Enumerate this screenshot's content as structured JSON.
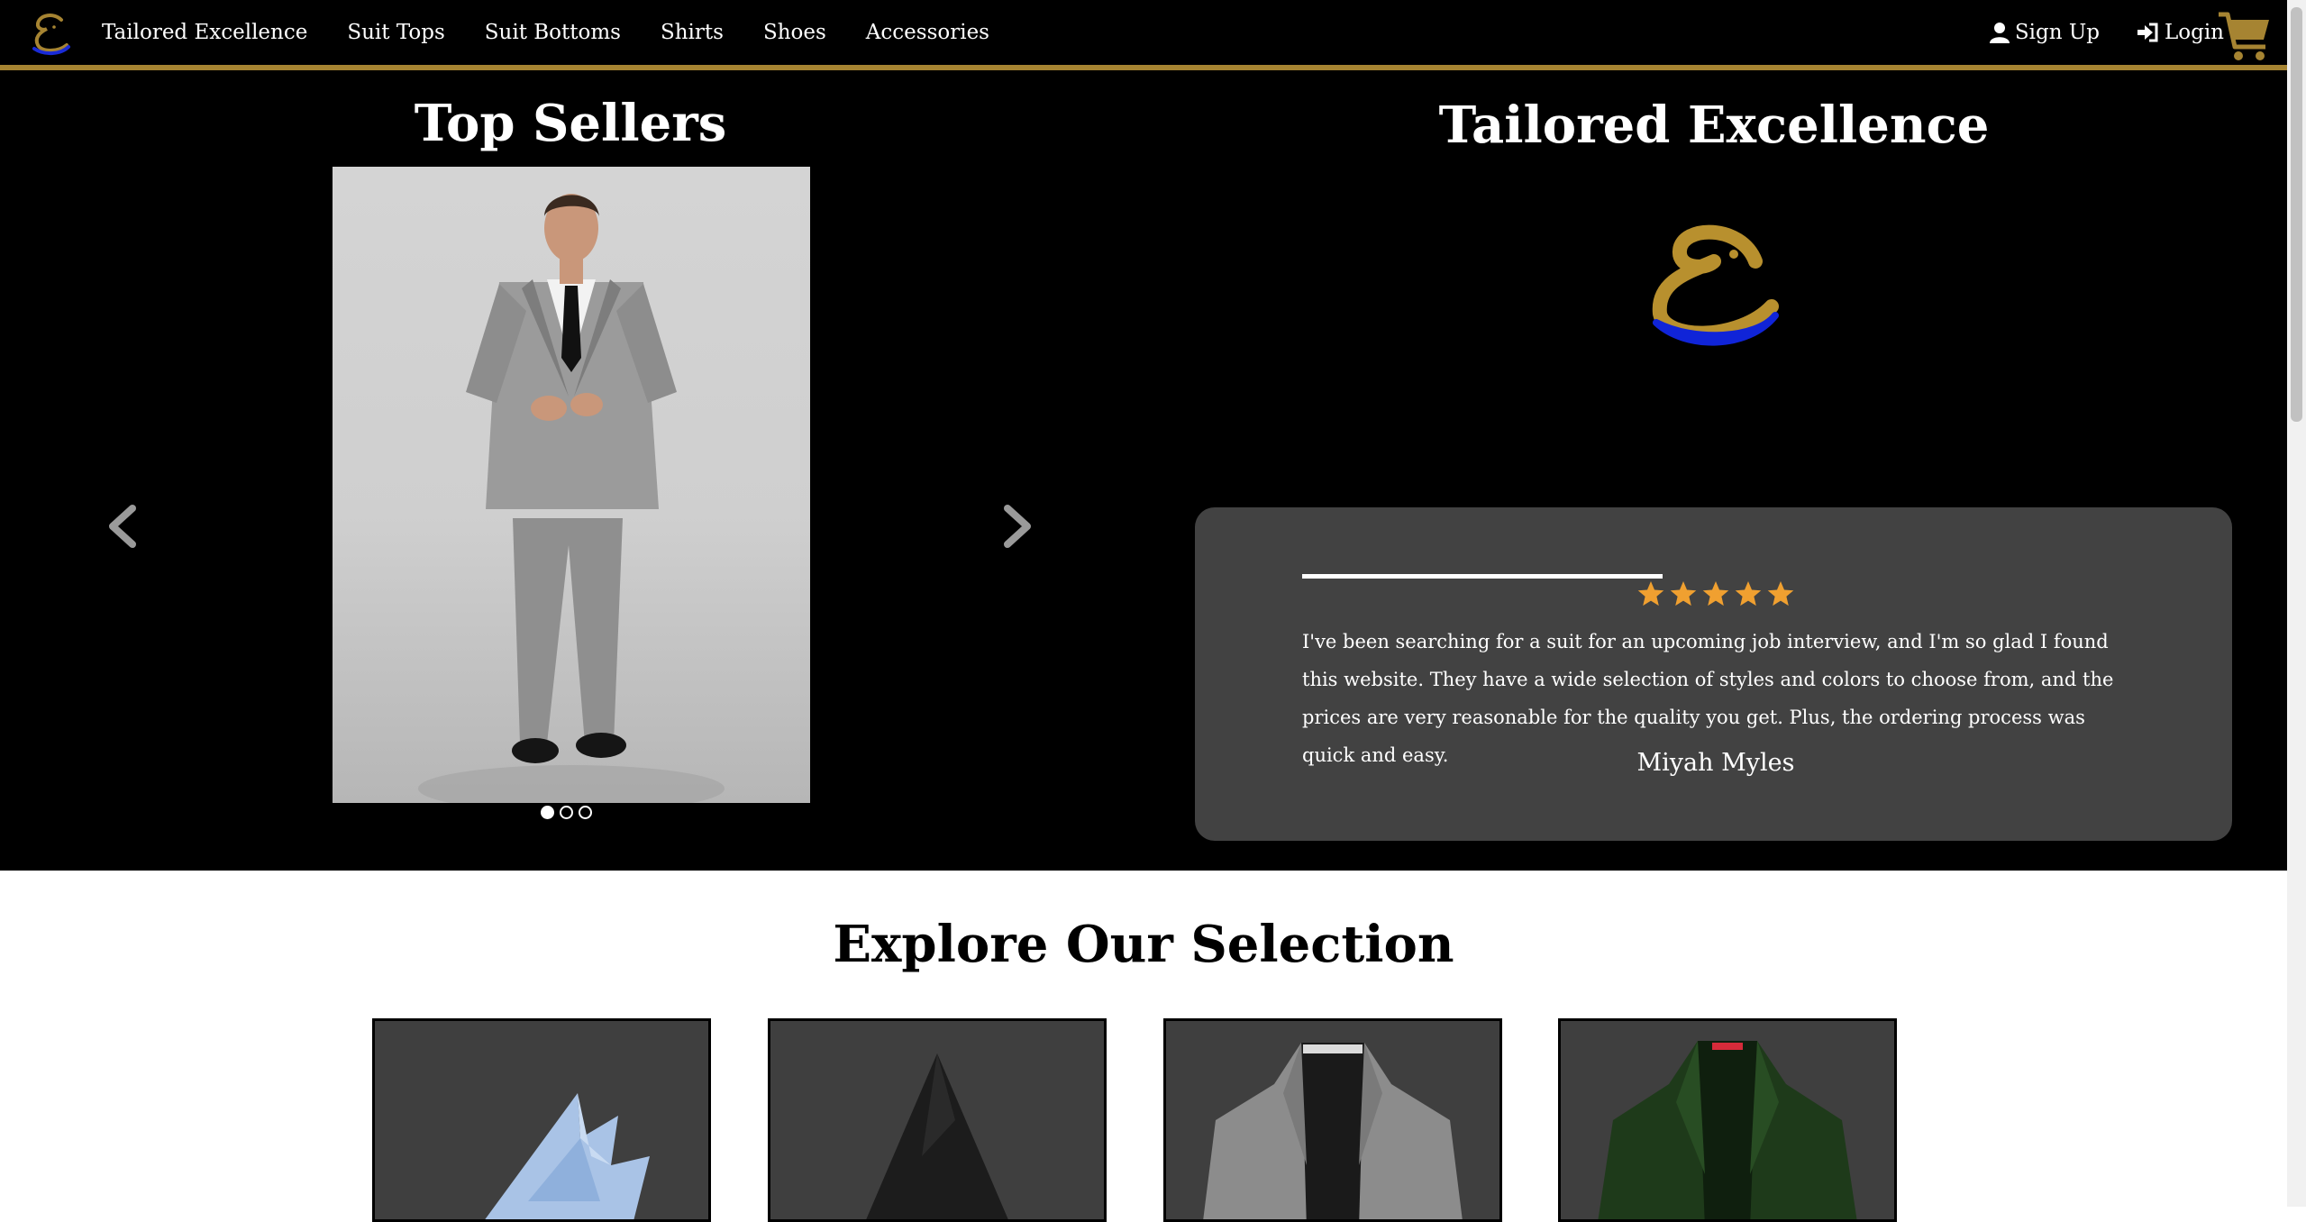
{
  "nav": {
    "brand": "Tailored Excellence",
    "links": [
      "Suit Tops",
      "Suit Bottoms",
      "Shirts",
      "Shoes",
      "Accessories"
    ],
    "signup": "Sign Up",
    "login": "Login",
    "icons": {
      "logo": "brand-logo-icon",
      "signup": "user-icon",
      "login": "sign-in-icon",
      "cart": "cart-icon"
    }
  },
  "hero": {
    "top_sellers_title": "Top Sellers",
    "carousel": {
      "slides": 3,
      "active": 1
    },
    "brand_title": "Tailored Excellence"
  },
  "review": {
    "rating": 5,
    "text": "I've been searching for a suit for an upcoming job interview, and I'm so glad I found this website. They have a wide selection of styles and colors to choose from, and the prices are very reasonable for the quality you get. Plus, the ordering process was quick and easy.",
    "author": "Miyah Myles"
  },
  "explore": {
    "title": "Explore Our Selection",
    "cards": [
      "pocket-square",
      "tie",
      "grey-blazer",
      "green-blazer"
    ]
  },
  "colors": {
    "gold": "#a68432",
    "black": "#000000",
    "review_bg": "#424242",
    "star": "#f0a030"
  }
}
